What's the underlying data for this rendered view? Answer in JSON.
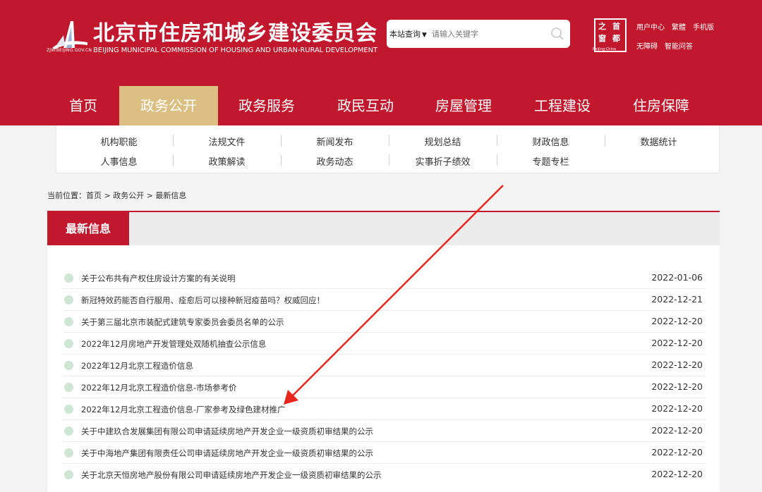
{
  "header": {
    "site_title": "北京市住房和城乡建设委员会",
    "site_subtitle": "BEIJING MUNICIPAL COMMISSION OF HOUSING AND URBAN-RURAL DEVELOPMENT",
    "logo_domain": "ZJW.BEIJING.GOV.CN",
    "search": {
      "scope_label": "本站查询",
      "placeholder": "请输入关键字"
    },
    "seal": {
      "chars": [
        "首",
        "都",
        "之",
        "窗"
      ],
      "caption": "Beijing-China"
    },
    "links_row1": [
      "用户中心",
      "繁體",
      "手机版"
    ],
    "links_row2": [
      "无障碍",
      "智能问答"
    ],
    "brand_color": "#c1182e",
    "active_color": "#dcbf83"
  },
  "nav": {
    "items": [
      "首页",
      "政务公开",
      "政务服务",
      "政民互动",
      "房屋管理",
      "工程建设",
      "住房保障"
    ],
    "active_index": 1
  },
  "submenu": {
    "row1": [
      "机构职能",
      "法规文件",
      "新闻发布",
      "规划总结",
      "财政信息",
      "数据统计"
    ],
    "row2": [
      "人事信息",
      "政策解读",
      "政务动态",
      "实事折子绩效",
      "专题专栏"
    ]
  },
  "breadcrumb": {
    "text": "当前位置：首页 > 政务公开 > 最新信息"
  },
  "panel": {
    "tab_label": "最新信息",
    "news": [
      {
        "title": "关于公布共有产权住房设计方案的有关说明",
        "date": "2022-01-06"
      },
      {
        "title": "新冠特效药能否自行服用、痊愈后可以接种新冠疫苗吗？权威回应！",
        "date": "2022-12-21"
      },
      {
        "title": "关于第三届北京市装配式建筑专家委员会委员名单的公示",
        "date": "2022-12-20"
      },
      {
        "title": "2022年12月房地产开发管理处双随机抽查公示信息",
        "date": "2022-12-20"
      },
      {
        "title": "2022年12月北京工程造价信息",
        "date": "2022-12-20"
      },
      {
        "title": "2022年12月北京工程造价信息-市场参考价",
        "date": "2022-12-20"
      },
      {
        "title": "2022年12月北京工程造价信息-厂家参考及绿色建材推广",
        "date": "2022-12-20"
      },
      {
        "title": "关于中建玖合发展集团有限公司申请延续房地产开发企业一级资质初审结果的公示",
        "date": "2022-12-20"
      },
      {
        "title": "关于中海地产集团有限责任公司申请延续房地产开发企业一级资质初审结果的公示",
        "date": "2022-12-20"
      },
      {
        "title": "关于北京天恒房地产股份有限公司申请延续房地产开发企业一级资质初审结果的公示",
        "date": "2022-12-20"
      }
    ]
  },
  "annotation": {
    "arrow_color": "#e8251c"
  }
}
